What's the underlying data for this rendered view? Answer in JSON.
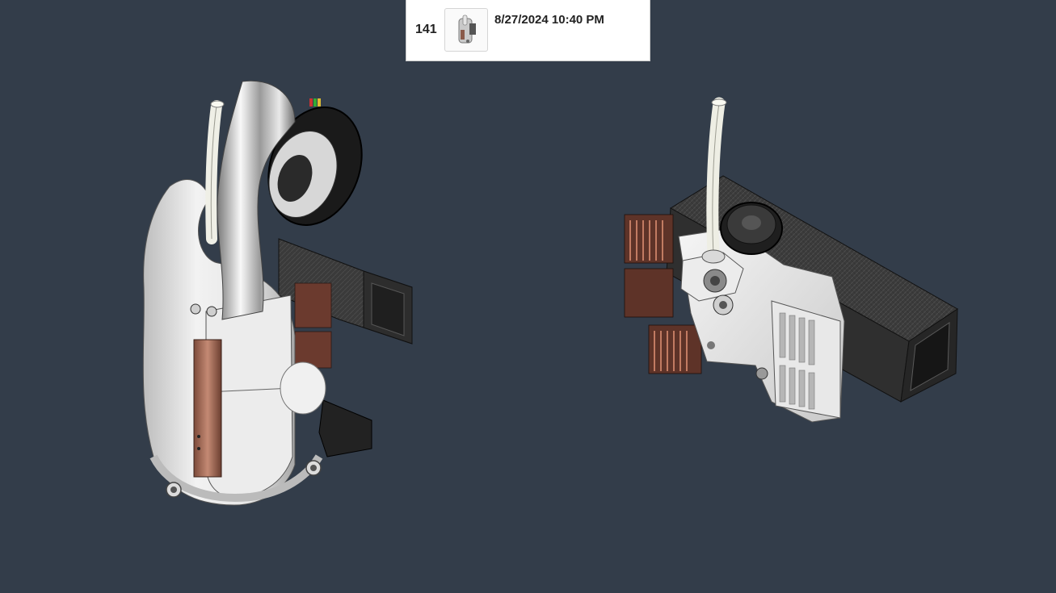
{
  "version_card": {
    "number": "141",
    "timestamp": "8/27/2024 10:40 PM",
    "thumbnail_icon": "model-thumbnail-icon"
  },
  "viewport": {
    "background_color": "#333d4a",
    "models": [
      {
        "name": "toolhead-assembly-front-icon"
      },
      {
        "name": "toolhead-assembly-rear-icon"
      }
    ]
  }
}
